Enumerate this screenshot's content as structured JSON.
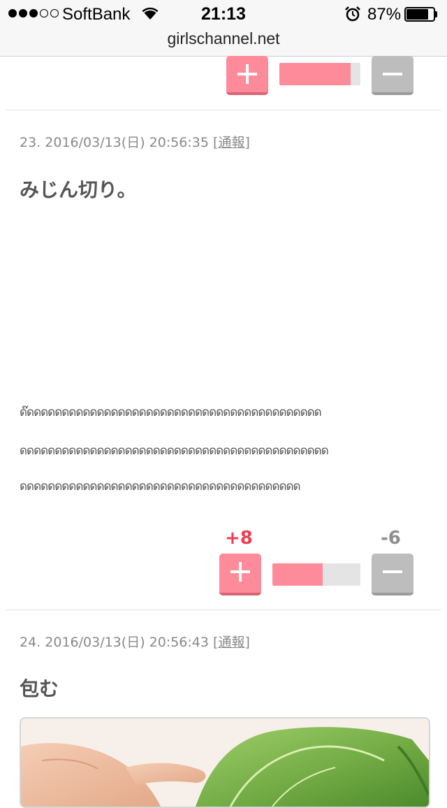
{
  "status_bar": {
    "carrier": "SoftBank",
    "time": "21:13",
    "battery_percent": "87%",
    "battery_level": 0.87,
    "signal_dots_filled": 3,
    "signal_dots_total": 5,
    "icons": [
      "signal-dots",
      "wifi-icon",
      "alarm-icon",
      "battery-icon"
    ]
  },
  "browser": {
    "url": "girlschannel.net"
  },
  "top_vote": {
    "plus_label": "+",
    "minus_label": "−",
    "positive_ratio": 0.88
  },
  "comments": [
    {
      "number": "23.",
      "timestamp": "2016/03/13(日) 20:56:35",
      "report_open": "[",
      "report_label": "通報",
      "report_close": "]",
      "body": "みじん切り。",
      "garbled_lines": [
        "ด๊ดดดดดดดดดดดดดดดดดดดดดดดดดดดดดดดดดดดดดดดดดด",
        "ดดดดดดดดดดดดดดดดดดดดดดดดดดดดดดดดดดดดดดดดดดดด",
        "ดดดดดดดดดดดดดดดดดดดดดดดดดดดดดดดดดดดดดดดด"
      ],
      "votes": {
        "plus_count": "+8",
        "minus_count": "-6",
        "positive_ratio": 0.57
      }
    },
    {
      "number": "24.",
      "timestamp": "2016/03/13(日) 20:56:43",
      "report_open": "[",
      "report_label": "通報",
      "report_close": "]",
      "body": "包む"
    }
  ],
  "colors": {
    "plus_accent": "#fd8b9a",
    "plus_count": "#f03c52",
    "minus_accent": "#bdbdbd",
    "minus_count": "#8e8e8e",
    "meta_text": "#888888",
    "body_text": "#555555"
  }
}
